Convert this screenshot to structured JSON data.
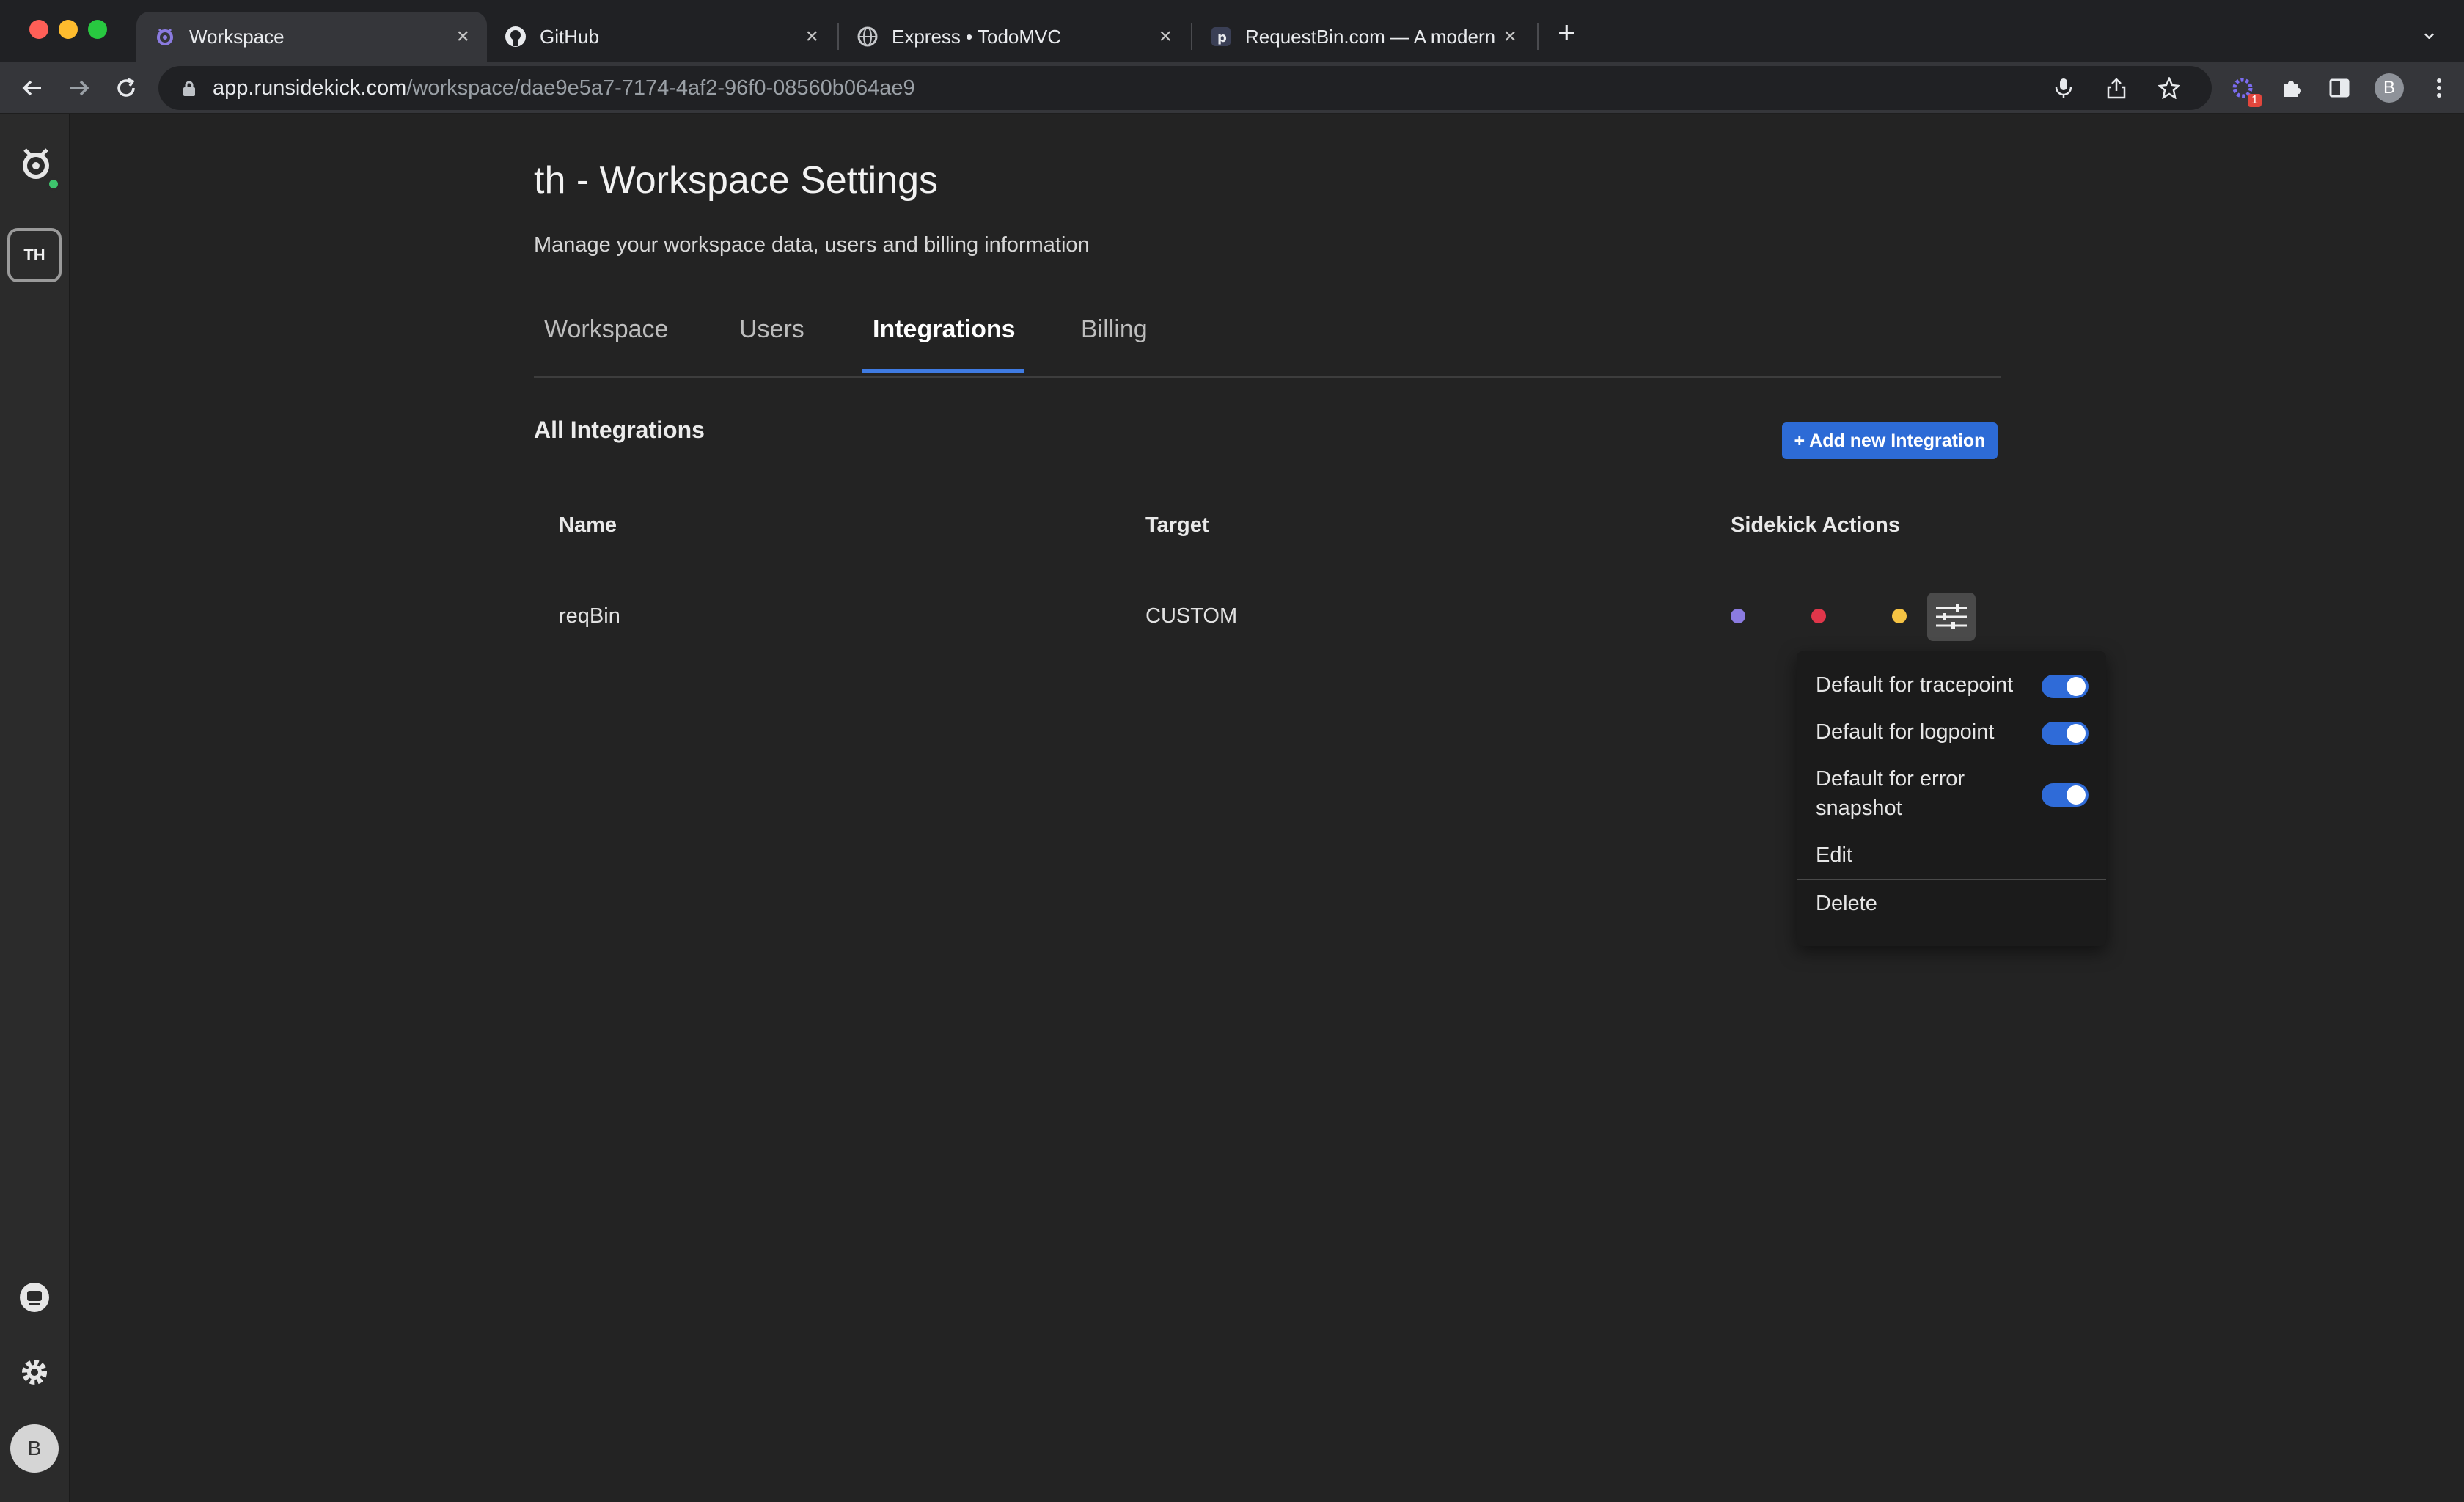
{
  "browser": {
    "tabs": [
      {
        "title": "Workspace",
        "icon": "sidekick-logo-icon"
      },
      {
        "title": "GitHub",
        "icon": "github-icon"
      },
      {
        "title": "Express • TodoMVC",
        "icon": "globe-icon"
      },
      {
        "title": "RequestBin.com — A modern r",
        "icon": "requestbin-icon"
      }
    ],
    "close_glyph": "×",
    "new_tab_glyph": "+",
    "tab_menu_glyph": "⌄",
    "url_host": "app.runsidekick.com",
    "url_path": "/workspace/dae9e5a7-7174-4af2-96f0-08560b064ae9",
    "extension_badge": "1",
    "profile_initial": "B"
  },
  "sidebar": {
    "workspace_initials": "TH",
    "user_initial": "B"
  },
  "page": {
    "title": "th - Workspace Settings",
    "subtitle": "Manage your workspace data, users and billing information",
    "tabs": [
      {
        "label": "Workspace"
      },
      {
        "label": "Users"
      },
      {
        "label": "Integrations"
      },
      {
        "label": "Billing"
      }
    ],
    "active_tab": "Integrations"
  },
  "integrations": {
    "section_title": "All Integrations",
    "add_button": "+ Add new Integration",
    "columns": [
      "Name",
      "Target",
      "Sidekick Actions"
    ],
    "rows": [
      {
        "name": "reqBin",
        "target": "CUSTOM"
      }
    ],
    "action_dot_colors": [
      "#8b7be0",
      "#e0364a",
      "#f5c343"
    ]
  },
  "menu": {
    "items": [
      {
        "label": "Default for tracepoint",
        "enabled": true
      },
      {
        "label": "Default for logpoint",
        "enabled": true
      },
      {
        "label": "Default for error snapshot",
        "enabled": true
      }
    ],
    "edit_label": "Edit",
    "delete_label": "Delete"
  },
  "colors": {
    "accent": "#2d6bd6",
    "background": "#232323",
    "status_online": "#3ec46d"
  }
}
